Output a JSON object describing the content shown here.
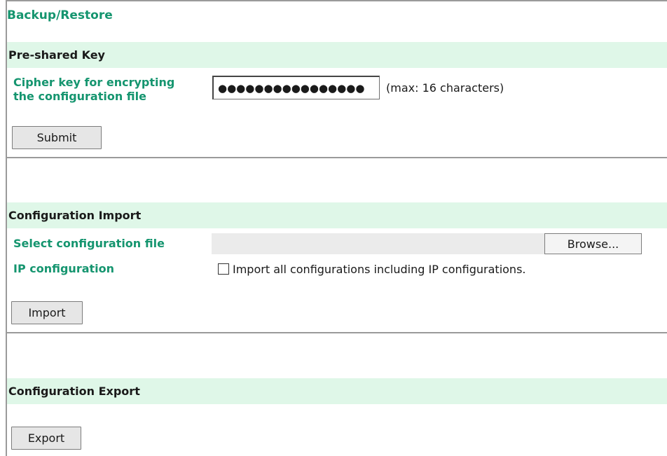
{
  "page": {
    "title": "Backup/Restore"
  },
  "preshared": {
    "header": "Pre-shared Key",
    "cipher_label_line1": "Cipher key for encrypting",
    "cipher_label_line2": "the configuration file",
    "cipher_value": "●●●●●●●●●●●●●●●●",
    "hint": "(max: 16 characters)",
    "submit_label": "Submit"
  },
  "import": {
    "header": "Configuration Import",
    "file_label": "Select configuration file",
    "browse_label": "Browse...",
    "ip_label": "IP configuration",
    "ip_checkbox_checked": false,
    "ip_checkbox_text": "Import all configurations including IP configurations.",
    "import_label": "Import"
  },
  "export": {
    "header": "Configuration Export",
    "export_label": "Export"
  },
  "colors": {
    "accent_text": "#15956f",
    "section_header_bg": "#dff7e8",
    "divider": "#9a9a9a"
  }
}
